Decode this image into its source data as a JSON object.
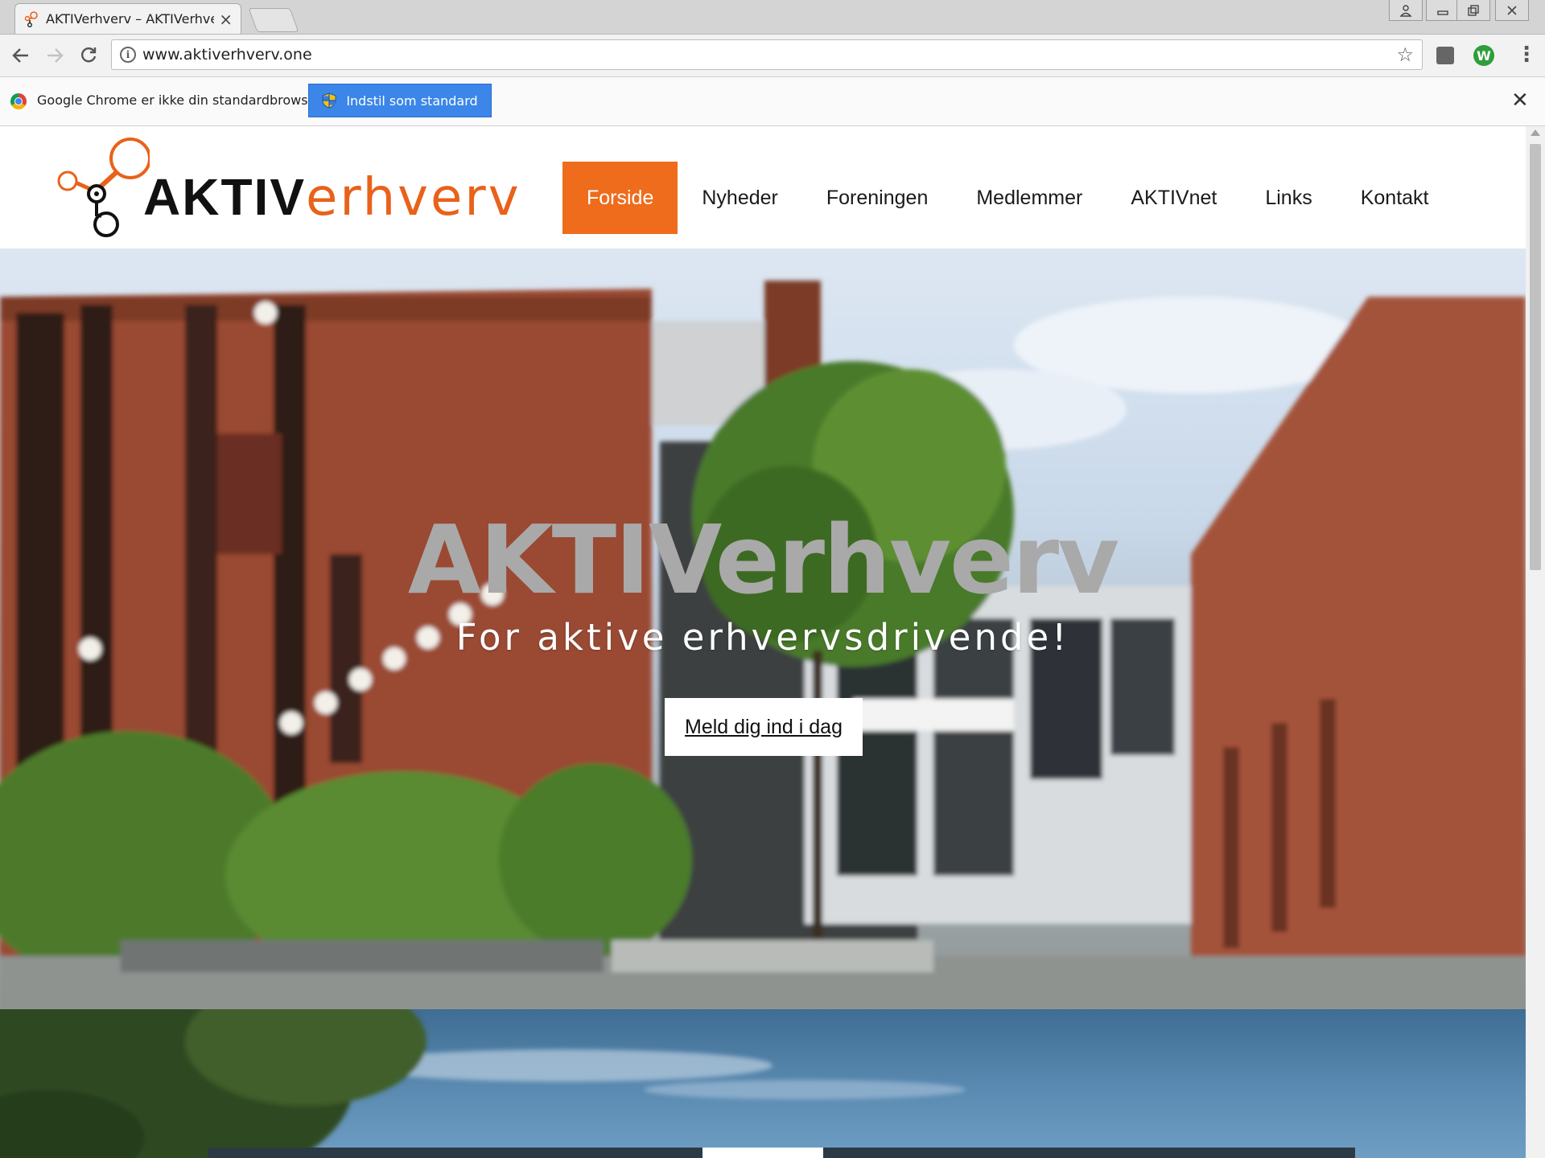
{
  "browser": {
    "tab_title": "AKTIVerhverv – AKTIVerhverv",
    "url": "www.aktiverhverv.one",
    "infobar_message": "Google Chrome er ikke din standardbrowser.",
    "set_default_label": "Indstil som standard",
    "icons": {
      "back": "back-arrow-icon",
      "forward": "forward-arrow-icon",
      "reload": "reload-icon",
      "info": "site-info-icon",
      "bookmark": "star-icon",
      "close": "close-icon",
      "menu": "kebab-menu-icon"
    }
  },
  "site": {
    "logo": {
      "aktiv": "AKTIV",
      "erhverv": "erhverv"
    },
    "nav": [
      "Forside",
      "Nyheder",
      "Foreningen",
      "Medlemmer",
      "AKTIVnet",
      "Links",
      "Kontakt"
    ],
    "active_nav": "Forside",
    "hero": {
      "title": "AKTIVerhverv",
      "subtitle": "For aktive erhvervsdrivende!",
      "cta": "Meld dig ind i dag"
    }
  },
  "colors": {
    "accent": "#ee6c1b",
    "logo_orange": "#e8621a",
    "infobar_button": "#3b86e8"
  }
}
